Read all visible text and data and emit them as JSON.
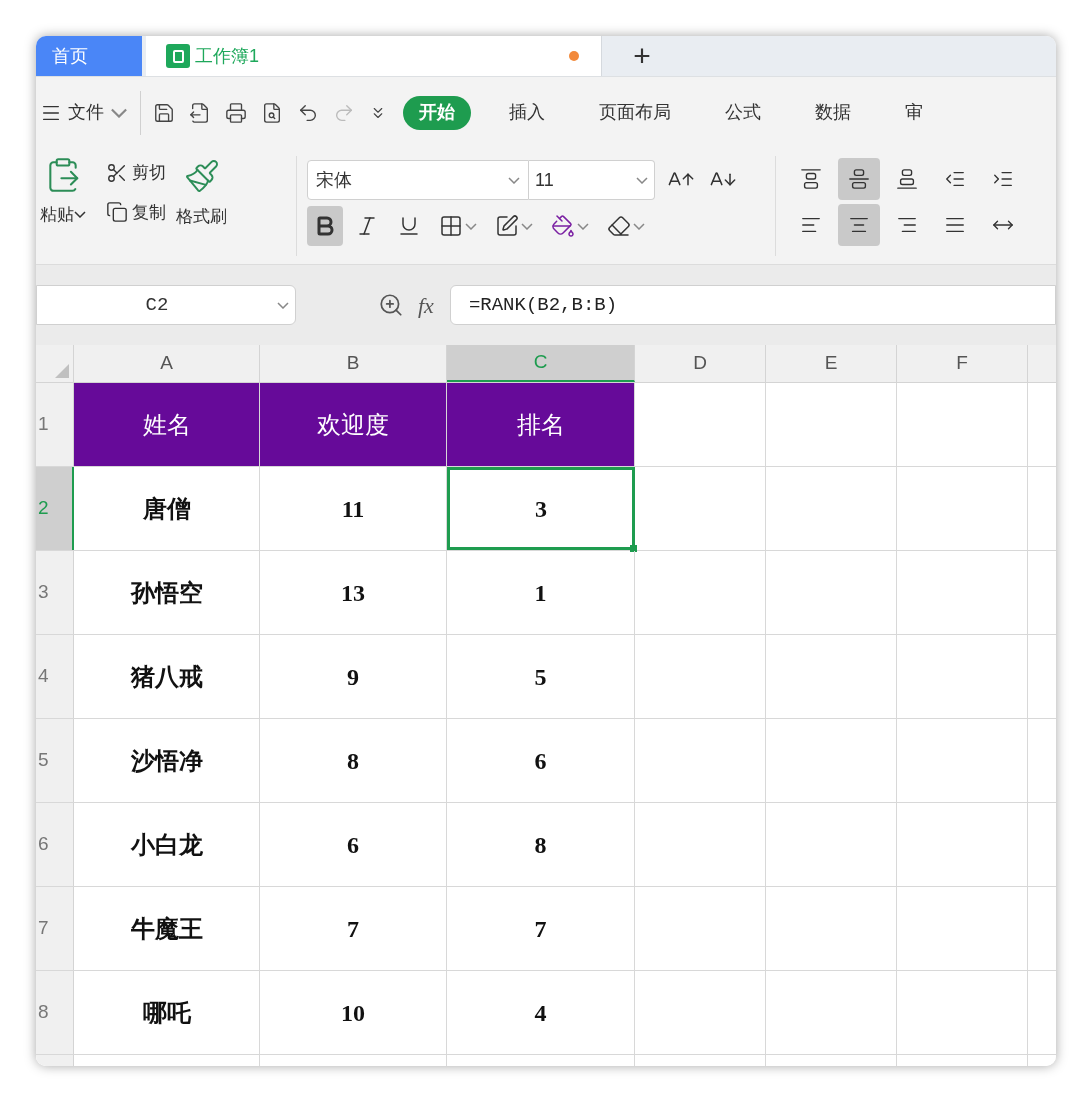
{
  "tabs": [
    {
      "label": "首页",
      "kind": "home",
      "selected": false
    },
    {
      "label": "工作簿1",
      "kind": "workbook",
      "selected": true,
      "unsaved": true
    }
  ],
  "new_tab": "+",
  "menu": {
    "file": "文件"
  },
  "ribbon_tabs": [
    {
      "label": "开始",
      "selected": true
    },
    {
      "label": "插入",
      "selected": false
    },
    {
      "label": "页面布局",
      "selected": false
    },
    {
      "label": "公式",
      "selected": false
    },
    {
      "label": "数据",
      "selected": false
    },
    {
      "label": "审",
      "selected": false
    }
  ],
  "clipboard": {
    "paste": "粘贴",
    "cut": "剪切",
    "copy": "复制",
    "format_painter": "格式刷"
  },
  "font": {
    "name": "宋体",
    "size": "11"
  },
  "format_buttons": [
    {
      "kind": "bold",
      "selected": true
    },
    {
      "kind": "italic",
      "selected": false
    },
    {
      "kind": "underline",
      "selected": false
    },
    {
      "kind": "borders",
      "selected": false
    },
    {
      "kind": "fill",
      "selected": false
    },
    {
      "kind": "fontcolor",
      "selected": false
    },
    {
      "kind": "clear",
      "selected": false
    }
  ],
  "align_buttons": [
    {
      "kind": "top",
      "selected": false
    },
    {
      "kind": "middle",
      "selected": true
    },
    {
      "kind": "bottom",
      "selected": false
    },
    {
      "kind": "outdent",
      "selected": false
    },
    {
      "kind": "indent",
      "selected": false
    },
    {
      "kind": "left",
      "selected": false
    },
    {
      "kind": "center",
      "selected": true
    },
    {
      "kind": "right",
      "selected": false
    },
    {
      "kind": "justify",
      "selected": false
    },
    {
      "kind": "distribute",
      "selected": false
    }
  ],
  "name_box": "C2",
  "formula_label": "fx",
  "formula": "=RANK(B2,B:B)",
  "columns": [
    {
      "label": "A",
      "selected": false
    },
    {
      "label": "B",
      "selected": false
    },
    {
      "label": "C",
      "selected": true
    },
    {
      "label": "D",
      "selected": false
    },
    {
      "label": "E",
      "selected": false
    },
    {
      "label": "F",
      "selected": false
    }
  ],
  "rows": [
    {
      "label": "1",
      "kind": "header",
      "selected": false,
      "cells": [
        {
          "text": "姓名",
          "selected": false
        },
        {
          "text": "欢迎度",
          "selected": false
        },
        {
          "text": "排名",
          "selected": false
        }
      ]
    },
    {
      "label": "2",
      "kind": "data",
      "selected": true,
      "cells": [
        {
          "text": "唐僧",
          "selected": false
        },
        {
          "text": "11",
          "selected": false
        },
        {
          "text": "3",
          "selected": true
        }
      ]
    },
    {
      "label": "3",
      "kind": "data",
      "selected": false,
      "cells": [
        {
          "text": "孙悟空",
          "selected": false
        },
        {
          "text": "13",
          "selected": false
        },
        {
          "text": "1",
          "selected": false
        }
      ]
    },
    {
      "label": "4",
      "kind": "data",
      "selected": false,
      "cells": [
        {
          "text": "猪八戒",
          "selected": false
        },
        {
          "text": "9",
          "selected": false
        },
        {
          "text": "5",
          "selected": false
        }
      ]
    },
    {
      "label": "5",
      "kind": "data",
      "selected": false,
      "cells": [
        {
          "text": "沙悟净",
          "selected": false
        },
        {
          "text": "8",
          "selected": false
        },
        {
          "text": "6",
          "selected": false
        }
      ]
    },
    {
      "label": "6",
      "kind": "data",
      "selected": false,
      "cells": [
        {
          "text": "小白龙",
          "selected": false
        },
        {
          "text": "6",
          "selected": false
        },
        {
          "text": "8",
          "selected": false
        }
      ]
    },
    {
      "label": "7",
      "kind": "data",
      "selected": false,
      "cells": [
        {
          "text": "牛魔王",
          "selected": false
        },
        {
          "text": "7",
          "selected": false
        },
        {
          "text": "7",
          "selected": false
        }
      ]
    },
    {
      "label": "8",
      "kind": "data",
      "selected": false,
      "cells": [
        {
          "text": "哪吒",
          "selected": false
        },
        {
          "text": "10",
          "selected": false
        },
        {
          "text": "4",
          "selected": false
        }
      ]
    }
  ]
}
